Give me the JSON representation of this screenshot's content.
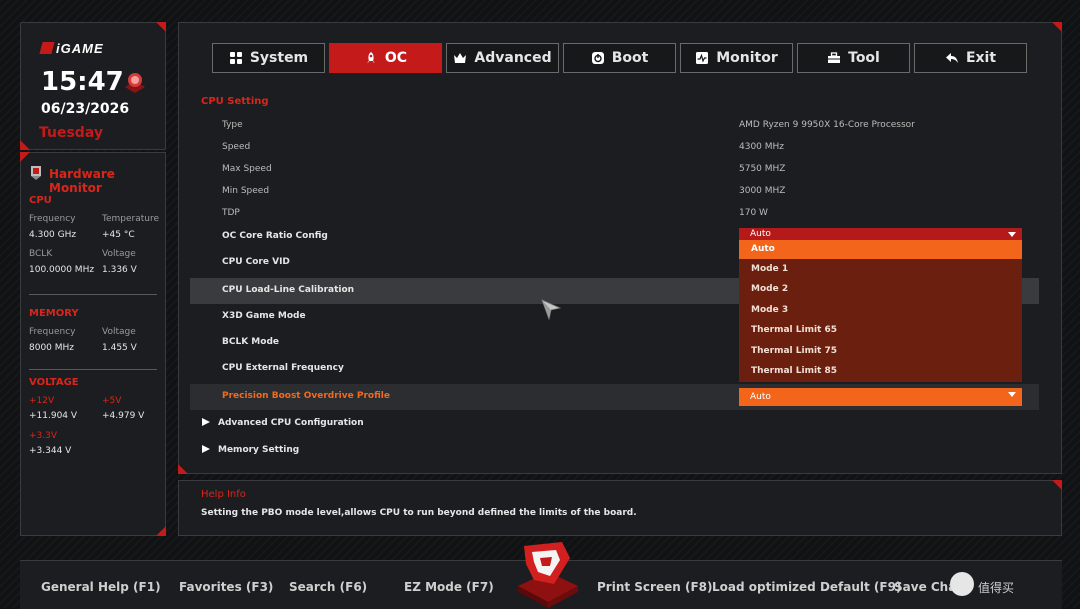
{
  "brand": "iGAME",
  "clock": {
    "time": "15:47",
    "date": "06/23/2026",
    "day": "Tuesday"
  },
  "hardware_monitor": {
    "title": "Hardware Monitor",
    "cpu": {
      "heading": "CPU",
      "frequency_label": "Frequency",
      "frequency": "4.300 GHz",
      "temperature_label": "Temperature",
      "temperature": "+45 °C",
      "bclk_label": "BCLK",
      "bclk": "100.0000 MHz",
      "voltage_label": "Voltage",
      "voltage": "1.336 V"
    },
    "memory": {
      "heading": "MEMORY",
      "frequency_label": "Frequency",
      "frequency": "8000 MHz",
      "voltage_label": "Voltage",
      "voltage": "1.455 V"
    },
    "voltage": {
      "heading": "VOLTAGE",
      "v12_label": "+12V",
      "v12": "+11.904 V",
      "v5_label": "+5V",
      "v5": "+4.979 V",
      "v33_label": "+3.3V",
      "v33": "+3.344 V"
    }
  },
  "tabs": [
    {
      "label": "System",
      "icon": "grid-icon"
    },
    {
      "label": "OC",
      "icon": "rocket-icon",
      "active": true
    },
    {
      "label": "Advanced",
      "icon": "crown-icon"
    },
    {
      "label": "Boot",
      "icon": "power-icon"
    },
    {
      "label": "Monitor",
      "icon": "monitor-icon"
    },
    {
      "label": "Tool",
      "icon": "toolbox-icon"
    },
    {
      "label": "Exit",
      "icon": "back-arrow-icon"
    }
  ],
  "cpu_setting": {
    "title": "CPU Setting",
    "info": [
      {
        "label": "Type",
        "value": "AMD Ryzen 9 9950X 16-Core Processor"
      },
      {
        "label": "Speed",
        "value": "4300 MHz"
      },
      {
        "label": "Max Speed",
        "value": "5750 MHZ"
      },
      {
        "label": "Min Speed",
        "value": "3000 MHZ"
      },
      {
        "label": "TDP",
        "value": "170 W"
      }
    ],
    "options": [
      "OC Core Ratio Config",
      "CPU Core VID",
      "CPU Load-Line Calibration",
      "X3D Game Mode",
      "BCLK Mode",
      "CPU External Frequency",
      "Precision Boost Overdrive Profile"
    ],
    "oc_core_ratio_value": "Auto",
    "dropdown_options": [
      "Auto",
      "Mode 1",
      "Mode 2",
      "Mode 3",
      "Thermal Limit 65",
      "Thermal Limit 75",
      "Thermal Limit 85"
    ],
    "pbo_value": "Auto",
    "submenus": [
      "Advanced CPU Configuration",
      "Memory Setting"
    ]
  },
  "help": {
    "title": "Help Info",
    "text": "Setting the PBO mode level,allows CPU to run beyond defined the limits of the board."
  },
  "function_keys": [
    "General Help (F1)",
    "Favorites (F3)",
    "Search (F6)",
    "EZ Mode (F7)",
    "Print Screen (F8)",
    "Load optimized Default (F9)",
    "Save Chan"
  ],
  "watermark": "值得买",
  "colors": {
    "accent": "#c41a1a",
    "orange": "#f2651a",
    "dropdown_bg": "#6b1f0e"
  }
}
